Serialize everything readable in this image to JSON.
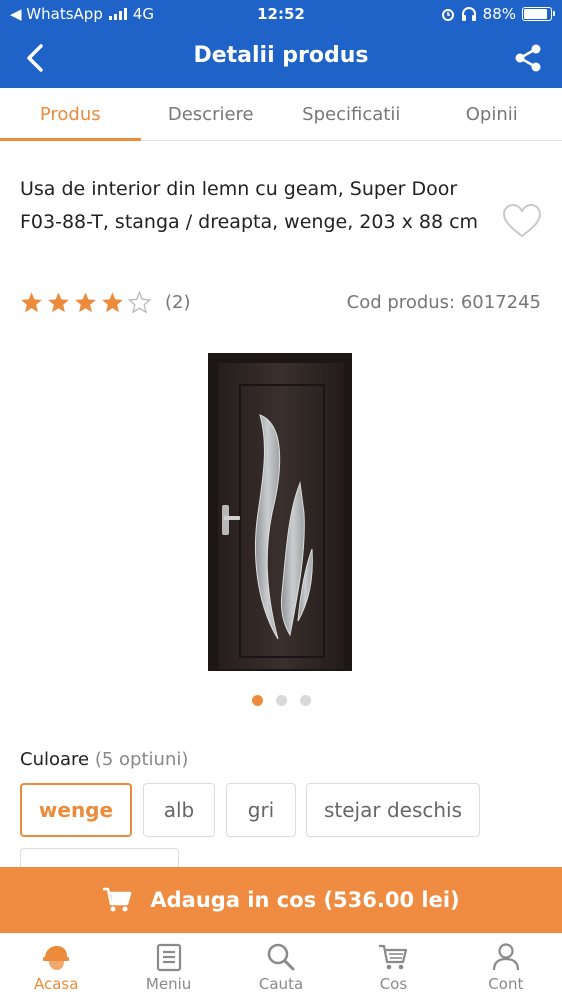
{
  "status": {
    "back_app": "◀ WhatsApp",
    "network": "4G",
    "time": "12:52",
    "battery": "88%"
  },
  "header": {
    "title": "Detalii produs"
  },
  "tabs": [
    {
      "label": "Produs",
      "active": true
    },
    {
      "label": "Descriere",
      "active": false
    },
    {
      "label": "Specificatii",
      "active": false
    },
    {
      "label": "Opinii",
      "active": false
    }
  ],
  "product": {
    "title": "Usa de interior din lemn cu geam, Super Door F03-88-T, stanga / dreapta, wenge, 203 x 88 cm",
    "rating": 4,
    "rating_max": 5,
    "review_count": "(2)",
    "code_label": "Cod produs: 6017245"
  },
  "gallery": {
    "image_count": 3,
    "active_index": 0
  },
  "colors": {
    "label": "Culoare",
    "count_label": "(5 optiuni)",
    "options": [
      "wenge",
      "alb",
      "gri",
      "stejar deschis"
    ],
    "selected": "wenge"
  },
  "cart": {
    "label": "Adauga in cos (536.00 lei)"
  },
  "nav": [
    {
      "label": "Acasa",
      "icon": "home-helmet-icon",
      "active": true
    },
    {
      "label": "Meniu",
      "icon": "menu-icon",
      "active": false
    },
    {
      "label": "Cauta",
      "icon": "search-icon",
      "active": false
    },
    {
      "label": "Cos",
      "icon": "cart-icon",
      "active": false
    },
    {
      "label": "Cont",
      "icon": "user-icon",
      "active": false
    }
  ],
  "theme": {
    "header_blue": "#1f63c9",
    "accent_orange": "#ec8b3b",
    "door_color": "#2e2523"
  }
}
